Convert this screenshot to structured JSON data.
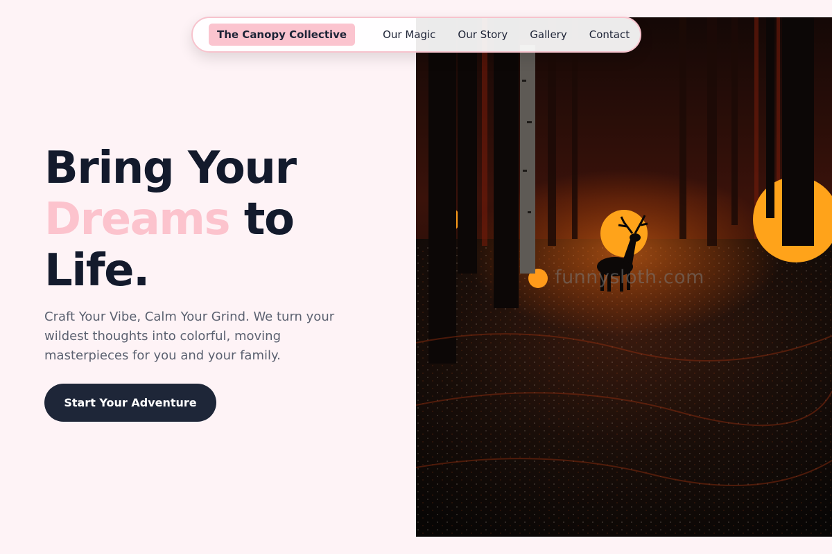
{
  "nav": {
    "brand": "The Canopy Collective",
    "links": [
      {
        "label": "Our Magic"
      },
      {
        "label": "Our Story"
      },
      {
        "label": "Gallery"
      },
      {
        "label": "Contact"
      }
    ]
  },
  "hero": {
    "title_line1": "Bring Your",
    "title_accent": "Dreams",
    "title_line2_rest": "to",
    "title_line3": "Life.",
    "subtitle": "Craft Your Vibe, Calm Your Grind. We turn your wildest thoughts into colorful, moving masterpieces for you and your family.",
    "cta_label": "Start Your Adventure"
  },
  "image": {
    "watermark": "funnysloth.com"
  },
  "colors": {
    "background": "#fef3f6",
    "accent_pink": "#fcc3cd",
    "dark_navy": "#1e2638",
    "text_muted": "#5b6170"
  }
}
